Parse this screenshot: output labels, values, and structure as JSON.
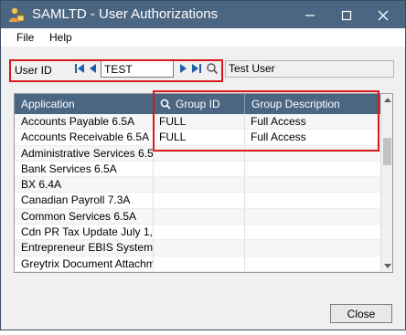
{
  "window": {
    "title": "SAMLTD - User Authorizations",
    "icons": {
      "app": "lock-person-icon",
      "minimize": "minimize-icon",
      "maximize": "maximize-icon",
      "close": "close-icon"
    }
  },
  "menu": {
    "file": "File",
    "help": "Help"
  },
  "user_id": {
    "label": "User ID",
    "value": "TEST",
    "user_name": "Test User",
    "nav_icons": [
      "first-record-icon",
      "previous-record-icon",
      "next-record-icon",
      "last-record-icon"
    ],
    "finder_icon": "search-icon"
  },
  "grid": {
    "columns": [
      "Application",
      "Group ID",
      "Group Description"
    ],
    "rows": [
      {
        "application": "Accounts Payable 6.5A",
        "group_id": "FULL",
        "group_description": "Full Access"
      },
      {
        "application": "Accounts Receivable 6.5A",
        "group_id": "FULL",
        "group_description": "Full Access"
      },
      {
        "application": "Administrative Services 6.5A",
        "group_id": "",
        "group_description": ""
      },
      {
        "application": "Bank Services 6.5A",
        "group_id": "",
        "group_description": ""
      },
      {
        "application": "BX 6.4A",
        "group_id": "",
        "group_description": ""
      },
      {
        "application": "Canadian Payroll 7.3A",
        "group_id": "",
        "group_description": ""
      },
      {
        "application": "Common Services 6.5A",
        "group_id": "",
        "group_description": ""
      },
      {
        "application": "Cdn PR Tax Update July 1, ...",
        "group_id": "",
        "group_description": ""
      },
      {
        "application": "Entrepreneur EBIS System ...",
        "group_id": "",
        "group_description": ""
      },
      {
        "application": "Greytrix Document Attachm...",
        "group_id": "",
        "group_description": ""
      }
    ]
  },
  "buttons": {
    "close": "Close"
  },
  "colors": {
    "titlebar": "#4b6683",
    "grid_header": "#4b6683",
    "nav_arrows": "#1f5fa8",
    "highlight": "#d7191c"
  }
}
